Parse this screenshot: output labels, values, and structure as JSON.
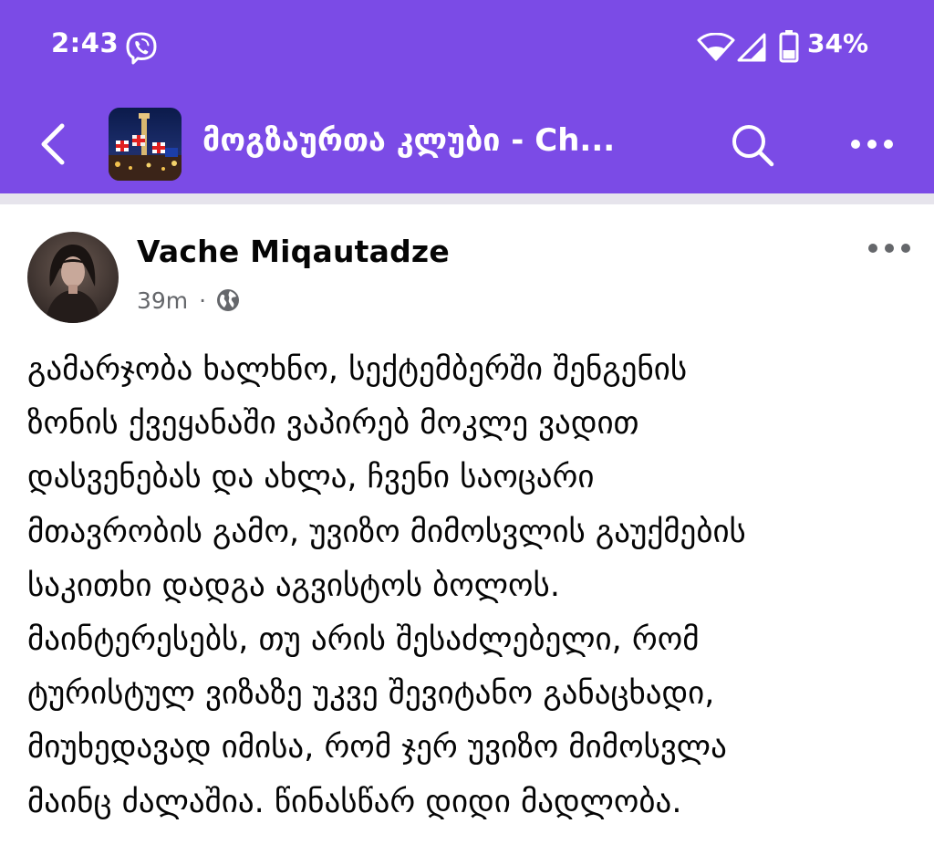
{
  "status_bar": {
    "time": "2:43",
    "battery_percent": "34%",
    "notification_icon": "viber-icon",
    "wifi_icon": "wifi-icon",
    "signal_icon": "cell-signal-icon",
    "battery_icon": "battery-icon",
    "battery_level": 0.34
  },
  "app_bar": {
    "title": "მოგზაურთა კლუბი - Ch...",
    "back_icon": "back-chevron-icon",
    "search_icon": "search-icon",
    "more_icon": "more-dots-icon",
    "background_color": "#7b4be6"
  },
  "post": {
    "author": "Vache Miqautadze",
    "time": "39m",
    "separator": "·",
    "privacy_icon": "globe-icon",
    "more_icon": "more-dots-icon",
    "body_lines": [
      "გამარჯობა ხალხნო, სექტემბერში შენგენის",
      "ზონის ქვეყანაში ვაპირებ მოკლე ვადით",
      "დასვენებას და ახლა, ჩვენი საოცარი",
      "მთავრობის გამო, უვიზო მიმოსვლის გაუქმების",
      "საკითხი დადგა აგვისტოს ბოლოს.",
      "მაინტერესებს, თუ არის შესაძლებელი, რომ",
      "ტურისტულ ვიზაზე უკვე შევიტანო განაცხადი,",
      "მიუხედავად იმისა, რომ ჯერ უვიზო მიმოსვლა",
      "მაინც ძალაშია. წინასწარ დიდი მადლობა."
    ]
  }
}
